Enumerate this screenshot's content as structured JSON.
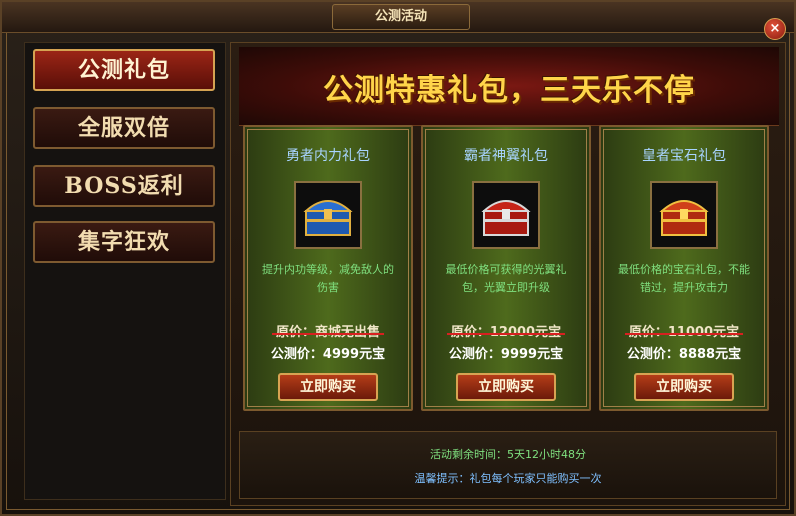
{
  "window": {
    "title": "公测活动",
    "close_label": "×"
  },
  "sidebar": {
    "items": [
      {
        "label": "公测礼包",
        "active": true
      },
      {
        "label": "全服双倍",
        "active": false
      },
      {
        "label": "BOSS返利",
        "active": false
      },
      {
        "label": "集字狂欢",
        "active": false
      }
    ]
  },
  "banner": {
    "text": "公测特惠礼包，三天乐不停"
  },
  "packages": [
    {
      "name": "勇者内力礼包",
      "icon": "treasure-chest-blue-icon",
      "description": "提升内功等级，减免敌人的伤害",
      "original_price": "原价：商城无出售",
      "sale_price": "公测价：4999元宝",
      "button": "立即购买",
      "chest_color": "#2a6fd0"
    },
    {
      "name": "霸者神翼礼包",
      "icon": "treasure-chest-red-silver-icon",
      "description": "最低价格可获得的光翼礼包，光翼立即升级",
      "original_price": "原价：12000元宝",
      "sale_price": "公测价：9999元宝",
      "button": "立即购买",
      "chest_color": "#c52418"
    },
    {
      "name": "皇者宝石礼包",
      "icon": "treasure-chest-red-gold-icon",
      "description": "最低价格的宝石礼包，不能错过，提升攻击力",
      "original_price": "原价：11000元宝",
      "sale_price": "公测价：8888元宝",
      "button": "立即购买",
      "chest_color": "#d0401a"
    }
  ],
  "footer": {
    "time_remaining": "活动剩余时间：5天12小时48分",
    "tip": "温馨提示：礼包每个玩家只能购买一次"
  }
}
